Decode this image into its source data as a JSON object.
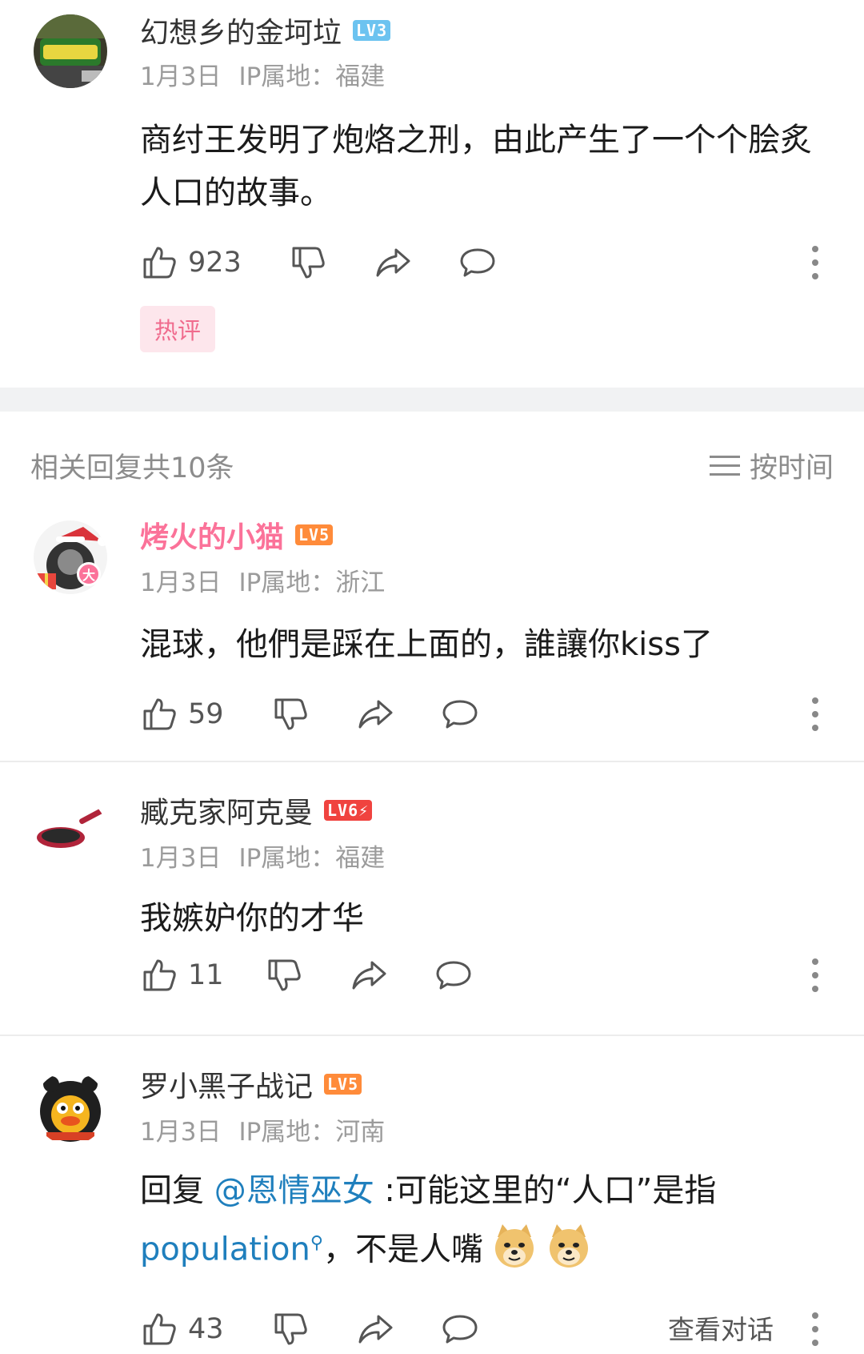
{
  "main_comment": {
    "username": "幻想乡的金坷垃",
    "level": "LV3",
    "date": "1月3日",
    "ip": "IP属地：福建",
    "text": "商纣王发明了炮烙之刑，由此产生了一个个脍炙人口的故事。",
    "likes": "923",
    "tag": "热评"
  },
  "replies_header": {
    "title": "相关回复共10条",
    "sort_label": "按时间"
  },
  "replies": [
    {
      "username": "烤火的小猫",
      "level": "LV5",
      "badge": "大",
      "date": "1月3日",
      "ip": "IP属地：浙江",
      "text": "混球，他們是踩在上面的，誰讓你kiss了",
      "likes": "59"
    },
    {
      "username": "臧克家阿克曼",
      "level": "LV6⚡",
      "date": "1月3日",
      "ip": "IP属地：福建",
      "text": "我嫉妒你的才华",
      "likes": "11"
    },
    {
      "username": "罗小黑子战记",
      "level": "LV5",
      "date": "1月3日",
      "ip": "IP属地：河南",
      "text_reply_prefix": "回复 ",
      "text_mention": "@恩情巫女",
      "text_part1": " :可能这里的“人口”是指",
      "text_link": "population",
      "text_part2": "，不是人嘴",
      "likes": "43",
      "view_conversation": "查看对话"
    }
  ],
  "colors": {
    "vip_pink": "#fb7299",
    "lv3_blue": "#6cc3f0",
    "lv5_orange": "#ff8b3a",
    "lv6_red": "#f0433f",
    "link_blue": "#1f7fbd"
  },
  "icons": [
    "like-icon",
    "dislike-icon",
    "share-icon",
    "comment-icon",
    "more-icon",
    "sort-icon",
    "search-icon",
    "doge-emoji"
  ]
}
